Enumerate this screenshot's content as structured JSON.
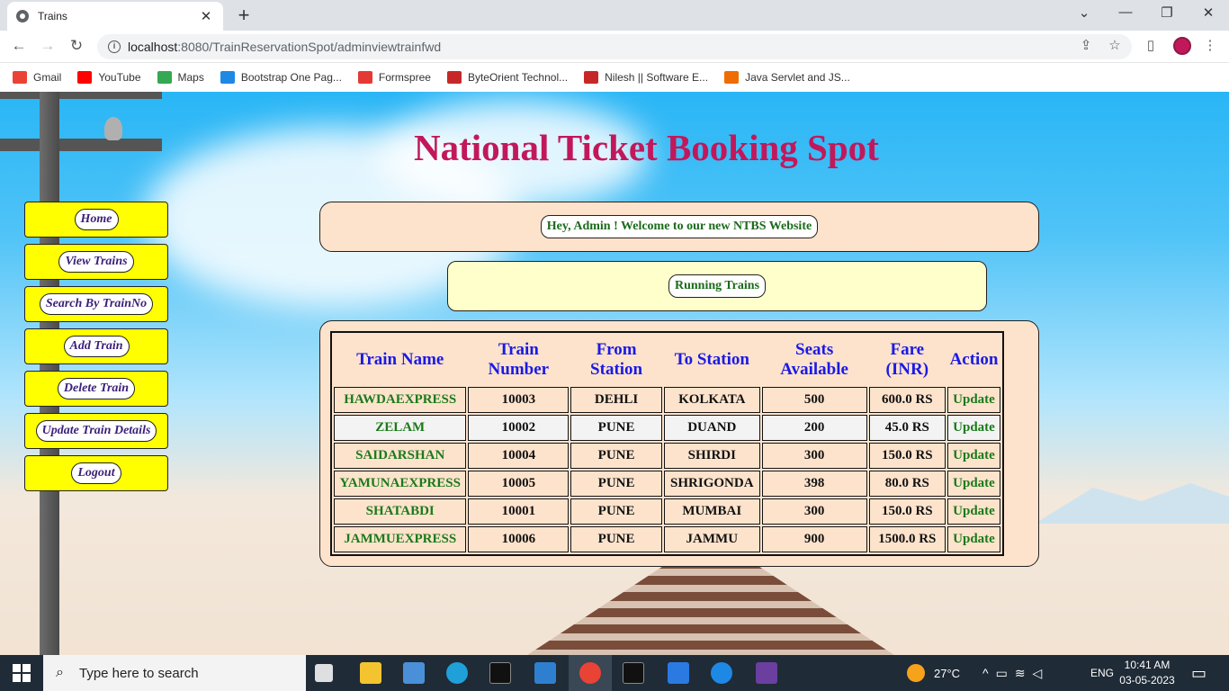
{
  "browser": {
    "tab_title": "Trains",
    "url_host": "localhost",
    "url_path": ":8080/TrainReservationSpot/adminviewtrainfwd",
    "bookmarks": [
      {
        "label": "Gmail",
        "color": "#ea4335"
      },
      {
        "label": "YouTube",
        "color": "#ff0000"
      },
      {
        "label": "Maps",
        "color": "#34a853"
      },
      {
        "label": "Bootstrap One Pag...",
        "color": "#1e88e5"
      },
      {
        "label": "Formspree",
        "color": "#e53935"
      },
      {
        "label": "ByteOrient Technol...",
        "color": "#c62828"
      },
      {
        "label": "Nilesh || Software E...",
        "color": "#c62828"
      },
      {
        "label": "Java Servlet and JS...",
        "color": "#ef6c00"
      }
    ]
  },
  "page": {
    "title": "National Ticket Booking Spot",
    "welcome": "Hey, Admin ! Welcome to our new NTBS Website",
    "section_heading": "Running Trains"
  },
  "sidebar": {
    "items": [
      {
        "label": "Home"
      },
      {
        "label": "View Trains"
      },
      {
        "label": "Search By TrainNo"
      },
      {
        "label": "Add Train"
      },
      {
        "label": "Delete Train"
      },
      {
        "label": "Update Train Details"
      },
      {
        "label": "Logout"
      }
    ]
  },
  "table": {
    "headers": [
      "Train Name",
      "Train Number",
      "From Station",
      "To Station",
      "Seats Available",
      "Fare (INR)",
      "Action"
    ],
    "rows": [
      {
        "name": "HAWDAEXPRESS",
        "number": "10003",
        "from": "DEHLI",
        "to": "KOLKATA",
        "seats": "500",
        "fare": "600.0 RS",
        "action": "Update"
      },
      {
        "name": "ZELAM",
        "number": "10002",
        "from": "PUNE",
        "to": "DUAND",
        "seats": "200",
        "fare": "45.0 RS",
        "action": "Update"
      },
      {
        "name": "SAIDARSHAN",
        "number": "10004",
        "from": "PUNE",
        "to": "SHIRDI",
        "seats": "300",
        "fare": "150.0 RS",
        "action": "Update"
      },
      {
        "name": "YAMUNAEXPRESS",
        "number": "10005",
        "from": "PUNE",
        "to": "SHRIGONDA",
        "seats": "398",
        "fare": "80.0 RS",
        "action": "Update"
      },
      {
        "name": "SHATABDI",
        "number": "10001",
        "from": "PUNE",
        "to": "MUMBAI",
        "seats": "300",
        "fare": "150.0 RS",
        "action": "Update"
      },
      {
        "name": "JAMMUEXPRESS",
        "number": "10006",
        "from": "PUNE",
        "to": "JAMMU",
        "seats": "900",
        "fare": "1500.0 RS",
        "action": "Update"
      }
    ]
  },
  "taskbar": {
    "search_placeholder": "Type here to search",
    "weather": "27°C",
    "language": "ENG",
    "time": "10:41 AM",
    "date": "03-05-2023"
  },
  "colors": {
    "title": "#c2185b",
    "sidebar_bg": "#ffff00",
    "header_text": "#1a1ae6",
    "green_text": "#1b7a1b"
  }
}
